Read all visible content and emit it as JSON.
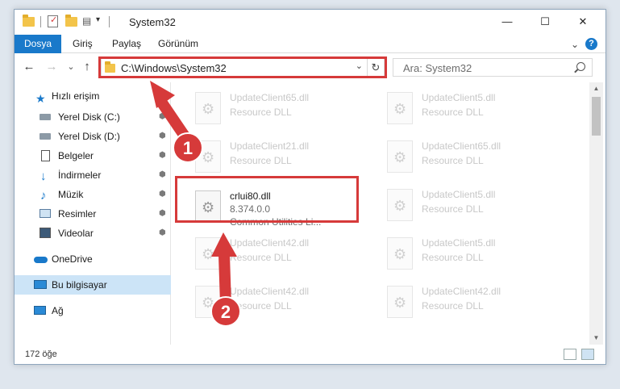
{
  "window": {
    "title": "System32",
    "minimize": "—",
    "maximize": "☐",
    "close": "✕"
  },
  "ribbon": {
    "tabs": [
      "Dosya",
      "Giriş",
      "Paylaş",
      "Görünüm"
    ],
    "expand": "⌄",
    "help": "?"
  },
  "navbar": {
    "back": "←",
    "forward": "→",
    "recent": "⌄",
    "up": "↑",
    "address": "C:\\Windows\\System32",
    "dropdown": "⌄",
    "refresh": "↻",
    "search_placeholder": "Ara: System32"
  },
  "sidebar": {
    "quick_access": "Hızlı erişim",
    "items": [
      {
        "label": "Yerel Disk (C:)",
        "icon": "drive-icon",
        "pin": "📌"
      },
      {
        "label": "Yerel Disk (D:)",
        "icon": "drive-icon",
        "pin": "📌"
      },
      {
        "label": "Belgeler",
        "icon": "documents-icon",
        "pin": "📌"
      },
      {
        "label": "İndirmeler",
        "icon": "downloads-icon",
        "pin": "📌"
      },
      {
        "label": "Müzik",
        "icon": "music-icon",
        "pin": "📌"
      },
      {
        "label": "Resimler",
        "icon": "pictures-icon",
        "pin": "📌"
      },
      {
        "label": "Videolar",
        "icon": "videos-icon",
        "pin": "📌"
      }
    ],
    "onedrive": "OneDrive",
    "this_pc": "Bu bilgisayar",
    "network": "Ağ"
  },
  "files": {
    "col1": [
      {
        "name": "UpdateClient65.dll",
        "type": "Resource DLL"
      },
      {
        "name": "UpdateClient21.dll",
        "type": "Resource DLL"
      },
      {
        "name": "crlui80.dll",
        "version": "8.374.0.0",
        "desc": "Common Utilities Li..."
      },
      {
        "name": "UpdateClient42.dll",
        "type": "Resource DLL"
      },
      {
        "name": "UpdateClient42.dll",
        "type": "Resource DLL"
      }
    ],
    "col2": [
      {
        "name": "UpdateClient5.dll",
        "type": "Resource DLL"
      },
      {
        "name": "UpdateClient65.dll",
        "type": "Resource DLL"
      },
      {
        "name": "UpdateClient5.dll",
        "type": "Resource DLL"
      },
      {
        "name": "UpdateClient5.dll",
        "type": "Resource DLL"
      },
      {
        "name": "UpdateClient42.dll",
        "type": "Resource DLL"
      }
    ]
  },
  "status": {
    "count": "172 öğe"
  },
  "annotations": {
    "step1": "1",
    "step2": "2",
    "color": "#d63a3a"
  }
}
